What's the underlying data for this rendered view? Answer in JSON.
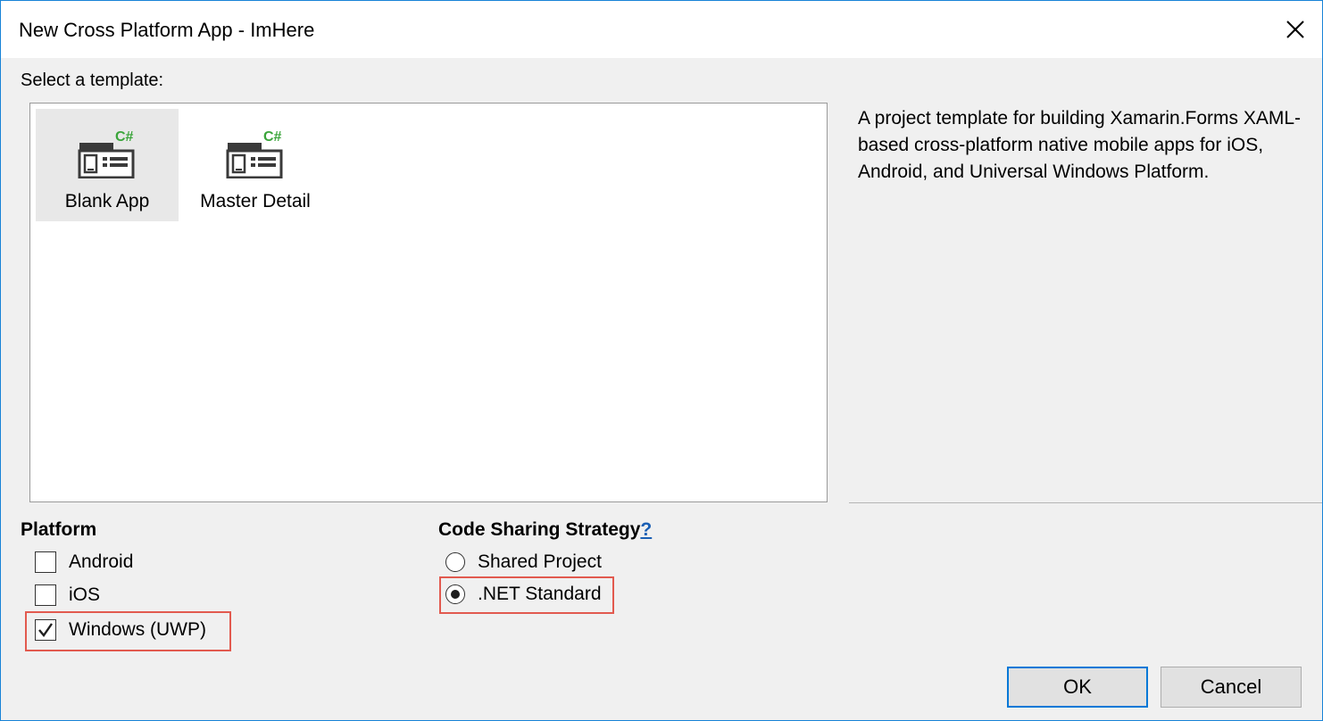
{
  "window": {
    "title": "New Cross Platform App - ImHere"
  },
  "templates": {
    "section_label": "Select a template:",
    "items": [
      {
        "label": "Blank App",
        "icon": "csharp-project-icon",
        "selected": true
      },
      {
        "label": "Master Detail",
        "icon": "csharp-project-icon",
        "selected": false
      }
    ],
    "icon_badge": "C#",
    "description": "A project template for building Xamarin.Forms XAML-based cross-platform native mobile apps for iOS, Android, and Universal Windows Platform."
  },
  "platform": {
    "header": "Platform",
    "options": [
      {
        "label": "Android",
        "checked": false
      },
      {
        "label": "iOS",
        "checked": false
      },
      {
        "label": "Windows (UWP)",
        "checked": true
      }
    ]
  },
  "code_sharing": {
    "header": "Code Sharing Strategy",
    "help": "?",
    "options": [
      {
        "label": "Shared Project",
        "selected": false
      },
      {
        "label": ".NET Standard",
        "selected": true
      }
    ]
  },
  "buttons": {
    "ok": "OK",
    "cancel": "Cancel"
  },
  "colors": {
    "accent": "#0078d7",
    "highlight": "#e25a4f",
    "csharp_badge": "#3ba53b"
  }
}
